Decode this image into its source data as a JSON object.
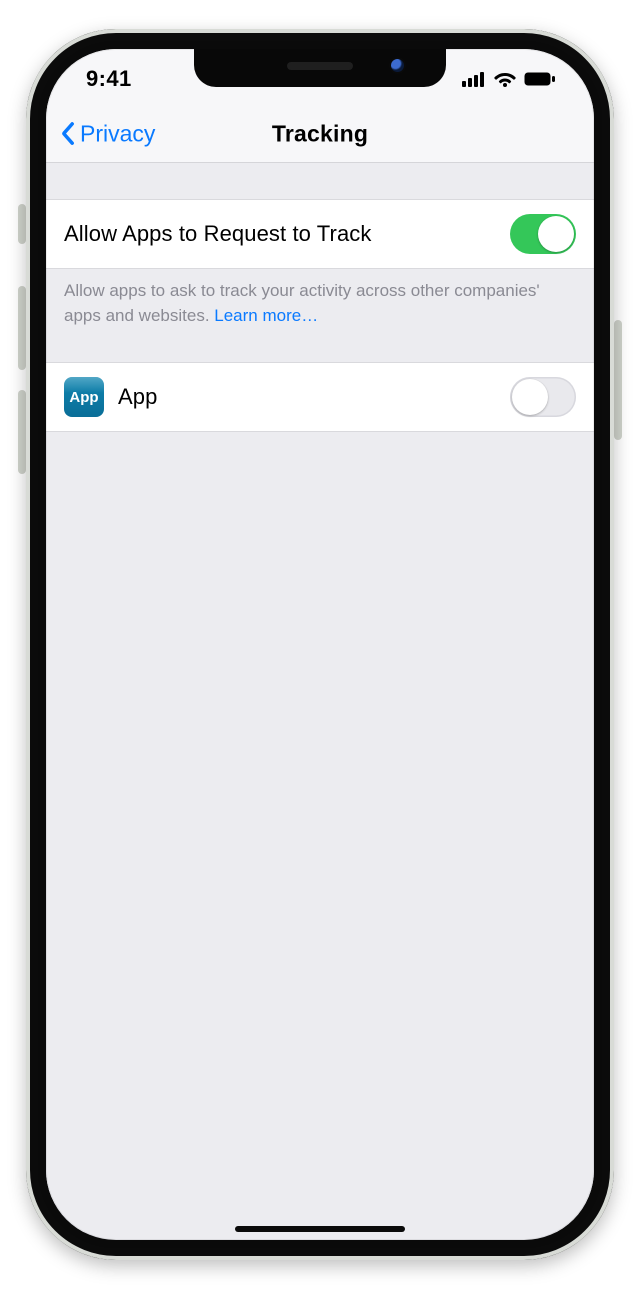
{
  "status": {
    "time": "9:41",
    "cellular_bars": 4,
    "wifi_bars": 3,
    "battery_level": 100
  },
  "nav": {
    "back": "Privacy",
    "title": "Tracking"
  },
  "settings": {
    "allow_apps": {
      "label": "Allow Apps to Request to Track",
      "enabled": true,
      "footer_text": "Allow apps to ask to track your activity across other companies' apps and websites. ",
      "learn_more": "Learn more…"
    },
    "apps": [
      {
        "name": "App",
        "icon_text": "App",
        "tracking_enabled": false
      }
    ]
  },
  "colors": {
    "ios_accent": "#0a7aff",
    "toggle_on": "#34c759",
    "toggle_off": "#e9e9ed",
    "background": "#ececf0"
  }
}
